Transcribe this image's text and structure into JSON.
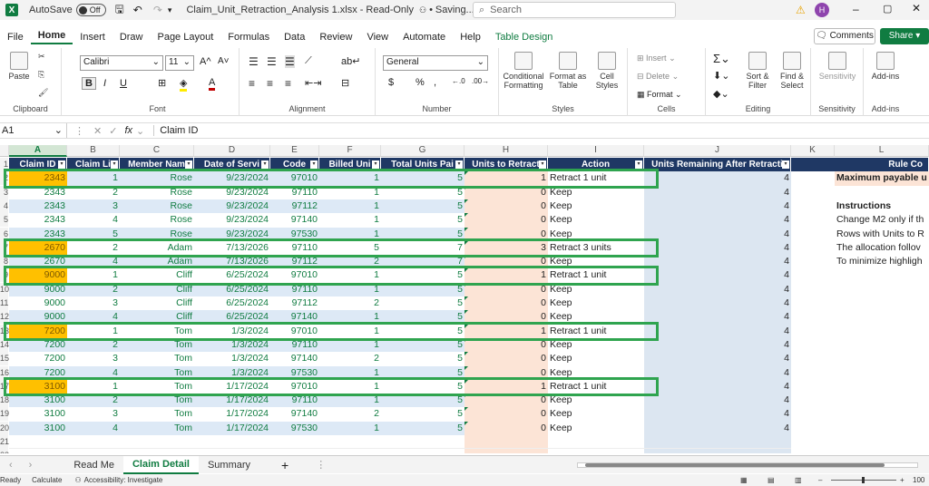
{
  "title_bar": {
    "autosave_label": "AutoSave",
    "autosave_state": "Off",
    "file_name": "Claim_Unit_Retraction_Analysis 1.xlsx",
    "file_status": "Read-Only",
    "saving_text": "Saving...",
    "search_placeholder": "Search",
    "avatar_initial": "H"
  },
  "menu": {
    "items": [
      "File",
      "Home",
      "Insert",
      "Draw",
      "Page Layout",
      "Formulas",
      "Data",
      "Review",
      "View",
      "Automate",
      "Help",
      "Table Design"
    ],
    "comments": "Comments",
    "share": "Share"
  },
  "ribbon": {
    "paste": "Paste",
    "clipboard": "Clipboard",
    "font_name": "Calibri",
    "font_size": "11",
    "font": "Font",
    "alignment": "Alignment",
    "number_format": "General",
    "number": "Number",
    "conditional_formatting": "Conditional Formatting",
    "format_as_table": "Format as Table",
    "cell_styles": "Cell Styles",
    "styles": "Styles",
    "insert": "Insert",
    "delete": "Delete",
    "format": "Format",
    "cells": "Cells",
    "sort_filter": "Sort & Filter",
    "find_select": "Find & Select",
    "editing": "Editing",
    "sensitivity": "Sensitivity",
    "addins": "Add-ins"
  },
  "formula_bar": {
    "name_box": "A1",
    "content": "Claim ID"
  },
  "columns": [
    "A",
    "B",
    "C",
    "D",
    "E",
    "F",
    "G",
    "H",
    "I",
    "J",
    "K",
    "L"
  ],
  "table": {
    "headers": [
      "Claim ID",
      "Claim Li",
      "Member Nam",
      "Date of Servi",
      "Code",
      "Billed Uni",
      "Total Units Pai",
      "Units to Retract",
      "Action",
      "Units Remaining After Retracti"
    ],
    "rows": [
      [
        "2343",
        "1",
        "Rose",
        "9/23/2024",
        "97010",
        "1",
        "5",
        "1",
        "Retract 1 unit",
        "4"
      ],
      [
        "2343",
        "2",
        "Rose",
        "9/23/2024",
        "97110",
        "1",
        "5",
        "0",
        "Keep",
        "4"
      ],
      [
        "2343",
        "3",
        "Rose",
        "9/23/2024",
        "97112",
        "1",
        "5",
        "0",
        "Keep",
        "4"
      ],
      [
        "2343",
        "4",
        "Rose",
        "9/23/2024",
        "97140",
        "1",
        "5",
        "0",
        "Keep",
        "4"
      ],
      [
        "2343",
        "5",
        "Rose",
        "9/23/2024",
        "97530",
        "1",
        "5",
        "0",
        "Keep",
        "4"
      ],
      [
        "2670",
        "2",
        "Adam",
        "7/13/2026",
        "97110",
        "5",
        "7",
        "3",
        "Retract 3 units",
        "4"
      ],
      [
        "2670",
        "4",
        "Adam",
        "7/13/2026",
        "97112",
        "2",
        "7",
        "0",
        "Keep",
        "4"
      ],
      [
        "9000",
        "1",
        "Cliff",
        "6/25/2024",
        "97010",
        "1",
        "5",
        "1",
        "Retract 1 unit",
        "4"
      ],
      [
        "9000",
        "2",
        "Cliff",
        "6/25/2024",
        "97110",
        "1",
        "5",
        "0",
        "Keep",
        "4"
      ],
      [
        "9000",
        "3",
        "Cliff",
        "6/25/2024",
        "97112",
        "2",
        "5",
        "0",
        "Keep",
        "4"
      ],
      [
        "9000",
        "4",
        "Cliff",
        "6/25/2024",
        "97140",
        "1",
        "5",
        "0",
        "Keep",
        "4"
      ],
      [
        "7200",
        "1",
        "Tom",
        "1/3/2024",
        "97010",
        "1",
        "5",
        "1",
        "Retract 1 unit",
        "4"
      ],
      [
        "7200",
        "2",
        "Tom",
        "1/3/2024",
        "97110",
        "1",
        "5",
        "0",
        "Keep",
        "4"
      ],
      [
        "7200",
        "3",
        "Tom",
        "1/3/2024",
        "97140",
        "2",
        "5",
        "0",
        "Keep",
        "4"
      ],
      [
        "7200",
        "4",
        "Tom",
        "1/3/2024",
        "97530",
        "1",
        "5",
        "0",
        "Keep",
        "4"
      ],
      [
        "3100",
        "1",
        "Tom",
        "1/17/2024",
        "97010",
        "1",
        "5",
        "1",
        "Retract 1 unit",
        "4"
      ],
      [
        "3100",
        "2",
        "Tom",
        "1/17/2024",
        "97110",
        "1",
        "5",
        "0",
        "Keep",
        "4"
      ],
      [
        "3100",
        "3",
        "Tom",
        "1/17/2024",
        "97140",
        "2",
        "5",
        "0",
        "Keep",
        "4"
      ],
      [
        "3100",
        "4",
        "Tom",
        "1/17/2024",
        "97530",
        "1",
        "5",
        "0",
        "Keep",
        "4"
      ]
    ]
  },
  "side_panel": {
    "rule_header": "Rule Co",
    "max_payable": "Maximum payable u",
    "instructions_title": "Instructions",
    "lines": [
      "Change M2 only if th",
      "Rows with Units to R",
      "The allocation follov",
      "To minimize highligh"
    ]
  },
  "sheet_tabs": [
    "Read Me",
    "Claim Detail",
    "Summary"
  ],
  "status_bar": {
    "ready": "Ready",
    "calculate": "Calculate",
    "accessibility": "Accessibility: Investigate",
    "zoom": "100"
  },
  "colors": {
    "excel_green": "#107c41",
    "header_navy": "#1f3864",
    "highlight_orange": "#ffc000",
    "retract_col": "#fce4d6",
    "remaining_col": "#dce6f1",
    "box_green": "#2fa44f"
  }
}
